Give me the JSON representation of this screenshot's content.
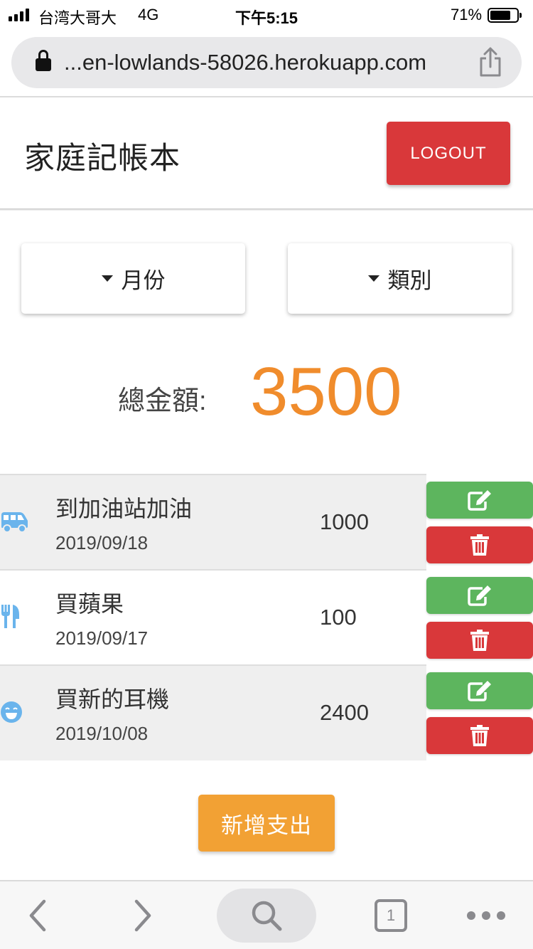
{
  "status_bar": {
    "carrier": "台湾大哥大",
    "network": "4G",
    "time": "下午5:15",
    "battery": "71%"
  },
  "browser": {
    "url": "...en-lowlands-58026.herokuapp.com",
    "tab_count": "1"
  },
  "header": {
    "title": "家庭記帳本",
    "logout_label": "LOGOUT"
  },
  "filters": {
    "month_label": "月份",
    "category_label": "類別"
  },
  "summary": {
    "total_label": "總金額:",
    "total_value": "3500"
  },
  "records": [
    {
      "icon": "van-icon",
      "title": "到加油站加油",
      "date": "2019/09/18",
      "amount": "1000"
    },
    {
      "icon": "utensils-icon",
      "title": "買蘋果",
      "date": "2019/09/17",
      "amount": "100"
    },
    {
      "icon": "smile-icon",
      "title": "買新的耳機",
      "date": "2019/10/08",
      "amount": "2400"
    }
  ],
  "actions": {
    "add_label": "新增支出"
  },
  "colors": {
    "accent_orange": "#f08c2c",
    "danger_red": "#d9383a",
    "success_green": "#5db55e",
    "icon_blue": "#6ab4ec"
  }
}
